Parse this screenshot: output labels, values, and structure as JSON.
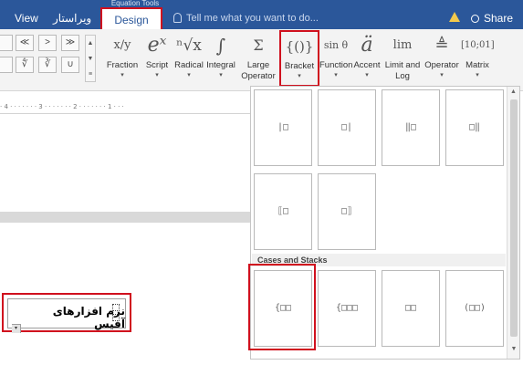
{
  "tabs": {
    "context_label": "Equation Tools",
    "view": "View",
    "farsi": "ویراستار",
    "design": "Design",
    "tell_me": "Tell me what you want to do...",
    "share": "Share"
  },
  "ribbon": {
    "symbols": [
      "≪",
      ">",
      "≫",
      "∜",
      "∛",
      "∪"
    ],
    "buttons": [
      {
        "key": "fraction",
        "glyph": "x/y",
        "label": "Fraction"
      },
      {
        "key": "script",
        "glyph": "eˣ",
        "label": "Script"
      },
      {
        "key": "radical",
        "glyph": "ⁿ√x",
        "label": "Radical"
      },
      {
        "key": "integral",
        "glyph": "∫",
        "label": "Integral"
      },
      {
        "key": "large-operator",
        "glyph": "Σ",
        "label": "Large",
        "label2": "Operator"
      },
      {
        "key": "bracket",
        "glyph": "{()}",
        "label": "Bracket"
      },
      {
        "key": "function",
        "glyph": "sin θ",
        "label": "Function"
      },
      {
        "key": "accent",
        "glyph": "ä",
        "label": "Accent"
      },
      {
        "key": "limit-log",
        "glyph": "lim",
        "label": "Limit and",
        "label2": "Log"
      },
      {
        "key": "operator",
        "glyph": "≜",
        "label": "Operator"
      },
      {
        "key": "matrix",
        "glyph": "[10;01]",
        "label": "Matrix"
      }
    ]
  },
  "ruler": {
    "text": "· 4 · · · · · · · 3 · · · · · · · 2 · · · · · · · 1 · · ·"
  },
  "document": {
    "equation_text": "نرم افزارهای آفیس"
  },
  "gallery": {
    "section_cases": "Cases and Stacks",
    "bracket_tiles": [
      "|□",
      "□|",
      "‖□",
      "□‖",
      "⟦□",
      "□⟧"
    ],
    "cases_tiles": [
      "{□□",
      "{□□□",
      "□□",
      "(□□)"
    ]
  },
  "colors": {
    "ribbon_blue": "#2b579a",
    "highlight_red": "#d0101e"
  }
}
